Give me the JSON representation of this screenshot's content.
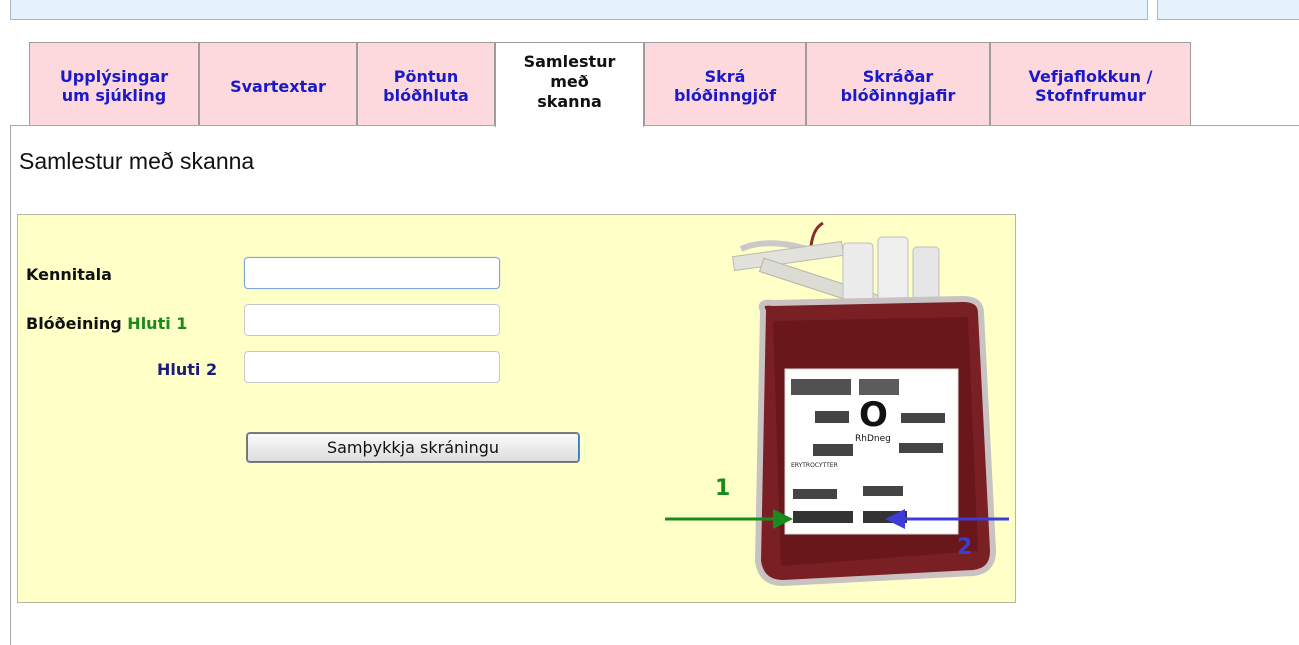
{
  "tabs": [
    {
      "label": "Upplýsingar\num sjúkling",
      "active": false
    },
    {
      "label": "Svartextar",
      "active": false
    },
    {
      "label": "Pöntun\nblóðhluta",
      "active": false
    },
    {
      "label": "Samlestur\nmeð\nskanna",
      "active": true
    },
    {
      "label": "Skrá\nblóðinngjöf",
      "active": false
    },
    {
      "label": "Skráðar\nblóðinngjafir",
      "active": false
    },
    {
      "label": "Vefjaflokkun /\nStofnfrumur",
      "active": false
    }
  ],
  "page": {
    "title": "Samlestur með skanna"
  },
  "form": {
    "kennitala_label": "Kennitala",
    "kennitala_value": "",
    "blodeining_label": "Blóðeining",
    "hluti1_label": "Hluti 1",
    "hluti1_value": "",
    "hluti2_label": "Hluti 2",
    "hluti2_value": "",
    "submit_label": "Samþykkja skráningu"
  },
  "bag": {
    "label_blood_type": "O",
    "label_rh": "RhDneg",
    "label_product": "ERYTROCYTTER",
    "arrow1_number": "1",
    "arrow2_number": "2",
    "arrow1_color": "#1a8a1a",
    "arrow2_color": "#3c3cd6"
  },
  "colors": {
    "tab_bg": "#fdd9de",
    "tab_text": "#1a1ac8",
    "form_bg": "#ffffc8",
    "hluti1_color": "#1b8a1b",
    "hluti2_color": "#1a1a7a"
  }
}
